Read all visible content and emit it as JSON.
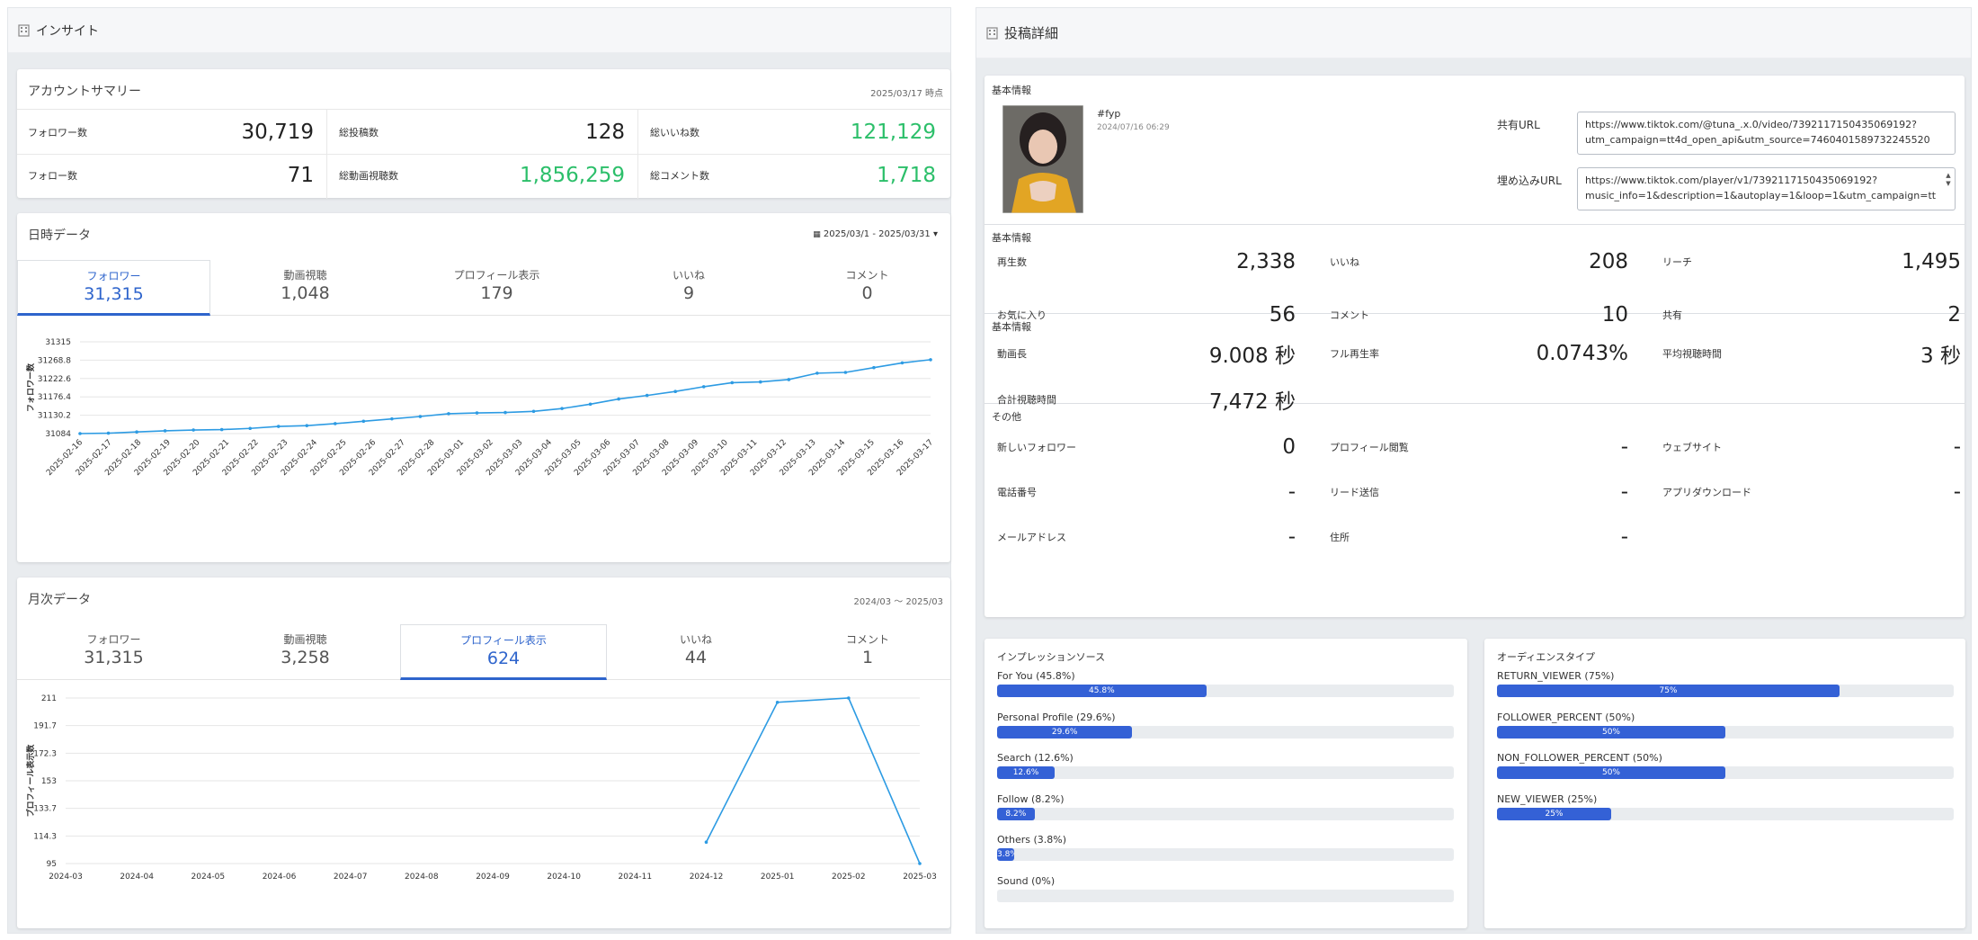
{
  "insight": {
    "header": "インサイト",
    "summary": {
      "title": "アカウントサマリー",
      "as_of": "2025/03/17 時点",
      "items": [
        {
          "label": "フォロワー数",
          "value": "30,719",
          "green": false
        },
        {
          "label": "総投稿数",
          "value": "128",
          "green": false
        },
        {
          "label": "総いいね数",
          "value": "121,129",
          "green": true
        },
        {
          "label": "フォロー数",
          "value": "71",
          "green": false
        },
        {
          "label": "総動画視聴数",
          "value": "1,856,259",
          "green": true
        },
        {
          "label": "総コメント数",
          "value": "1,718",
          "green": true
        }
      ]
    },
    "daily": {
      "title": "日時データ",
      "date_range": "2025/03/1 - 2025/03/31",
      "tabs": [
        {
          "label": "フォロワー",
          "value": "31,315"
        },
        {
          "label": "動画視聴",
          "value": "1,048"
        },
        {
          "label": "プロフィール表示",
          "value": "179"
        },
        {
          "label": "いいね",
          "value": "9"
        },
        {
          "label": "コメント",
          "value": "0"
        }
      ],
      "active_tab": 0
    },
    "monthly": {
      "title": "月次データ",
      "date_range": "2024/03 ～ 2025/03",
      "tabs": [
        {
          "label": "フォロワー",
          "value": "31,315"
        },
        {
          "label": "動画視聴",
          "value": "3,258"
        },
        {
          "label": "プロフィール表示",
          "value": "624"
        },
        {
          "label": "いいね",
          "value": "44"
        },
        {
          "label": "コメント",
          "value": "1"
        }
      ],
      "active_tab": 2
    }
  },
  "chart_data": [
    {
      "type": "line",
      "ylabel": "フォロワー数",
      "ylim": [
        31084,
        31315
      ],
      "yticks": [
        "31315",
        "31268.8",
        "31222.6",
        "31176.4",
        "31130.2",
        "31084"
      ],
      "x": [
        "2025-02-16",
        "2025-02-17",
        "2025-02-18",
        "2025-02-19",
        "2025-02-20",
        "2025-02-21",
        "2025-02-22",
        "2025-02-23",
        "2025-02-24",
        "2025-02-25",
        "2025-02-26",
        "2025-02-27",
        "2025-02-28",
        "2025-03-01",
        "2025-03-02",
        "2025-03-03",
        "2025-03-04",
        "2025-03-05",
        "2025-03-06",
        "2025-03-07",
        "2025-03-08",
        "2025-03-09",
        "2025-03-10",
        "2025-03-11",
        "2025-03-12",
        "2025-03-13",
        "2025-03-14",
        "2025-03-15",
        "2025-03-16",
        "2025-03-17"
      ],
      "values": [
        31084,
        31085,
        31088,
        31091,
        31093,
        31094,
        31097,
        31102,
        31104,
        31109,
        31115,
        31121,
        31127,
        31134,
        31136,
        31137,
        31140,
        31147,
        31158,
        31171,
        31180,
        31190,
        31202,
        31212,
        31214,
        31220,
        31236,
        31238,
        31250,
        31262,
        31270
      ],
      "color": "#2d9be3"
    },
    {
      "type": "line",
      "ylabel": "プロフィール表示数",
      "ylim": [
        95,
        211
      ],
      "yticks": [
        "211",
        "191.7",
        "172.3",
        "153",
        "133.7",
        "114.3",
        "95"
      ],
      "x": [
        "2024-03",
        "2024-04",
        "2024-05",
        "2024-06",
        "2024-07",
        "2024-08",
        "2024-09",
        "2024-10",
        "2024-11",
        "2024-12",
        "2025-01",
        "2025-02",
        "2025-03"
      ],
      "values": [
        null,
        null,
        null,
        null,
        null,
        null,
        null,
        null,
        null,
        110,
        208,
        211,
        95
      ],
      "color": "#2d9be3"
    }
  ],
  "post": {
    "header": "投稿詳細",
    "basic_label_1": "基本情報",
    "hashtag": "#fyp",
    "post_date": "2024/07/16 06:29",
    "share_url_label": "共有URL",
    "share_url_line1": "https://www.tiktok.com/@tuna_.x.0/video/7392117150435069192?",
    "share_url_line2": "utm_campaign=tt4d_open_api&utm_source=7460401589732245520",
    "embed_url_label": "埋め込みURL",
    "embed_url_line1": "https://www.tiktok.com/player/v1/7392117150435069192?",
    "embed_url_line2": "music_info=1&description=1&autoplay=1&loop=1&utm_campaign=tt",
    "basic_label_2": "基本情報",
    "stats": [
      {
        "label": "再生数",
        "value": "2,338"
      },
      {
        "label": "いいね",
        "value": "208"
      },
      {
        "label": "リーチ",
        "value": "1,495"
      },
      {
        "label": "お気に入り",
        "value": "56"
      },
      {
        "label": "コメント",
        "value": "10"
      },
      {
        "label": "共有",
        "value": "2"
      }
    ],
    "basic_label_3": "基本情報",
    "video_stats": [
      {
        "label": "動画長",
        "value": "9.008 秒"
      },
      {
        "label": "フル再生率",
        "value": "0.0743%"
      },
      {
        "label": "平均視聴時間",
        "value": "3 秒"
      },
      {
        "label": "合計視聴時間",
        "value": "7,472 秒"
      }
    ],
    "other_label": "その他",
    "other": [
      {
        "label": "新しいフォロワー",
        "value": "0"
      },
      {
        "label": "プロフィール閲覧",
        "value": "-"
      },
      {
        "label": "ウェブサイト",
        "value": "-"
      },
      {
        "label": "電話番号",
        "value": "-"
      },
      {
        "label": "リード送信",
        "value": "-"
      },
      {
        "label": "アプリダウンロード",
        "value": "-"
      },
      {
        "label": "メールアドレス",
        "value": "-"
      },
      {
        "label": "住所",
        "value": "-"
      }
    ]
  },
  "impression": {
    "title": "インプレッションソース",
    "items": [
      {
        "label": "For You (45.8%)",
        "pct": 45.8,
        "bar_text": "45.8%"
      },
      {
        "label": "Personal Profile (29.6%)",
        "pct": 29.6,
        "bar_text": "29.6%"
      },
      {
        "label": "Search (12.6%)",
        "pct": 12.6,
        "bar_text": "12.6%"
      },
      {
        "label": "Follow (8.2%)",
        "pct": 8.2,
        "bar_text": "8.2%"
      },
      {
        "label": "Others (3.8%)",
        "pct": 3.8,
        "bar_text": "3.8%"
      },
      {
        "label": "Sound (0%)",
        "pct": 0,
        "bar_text": ""
      }
    ]
  },
  "audience": {
    "title": "オーディエンスタイプ",
    "items": [
      {
        "label": "RETURN_VIEWER (75%)",
        "pct": 75,
        "bar_text": "75%"
      },
      {
        "label": "FOLLOWER_PERCENT (50%)",
        "pct": 50,
        "bar_text": "50%"
      },
      {
        "label": "NON_FOLLOWER_PERCENT (50%)",
        "pct": 50,
        "bar_text": "50%"
      },
      {
        "label": "NEW_VIEWER (25%)",
        "pct": 25,
        "bar_text": "25%"
      }
    ]
  },
  "colors": {
    "accent": "#2e64cc",
    "green": "#2cbf6a",
    "line": "#2d9be3",
    "bar": "#3461d6"
  }
}
